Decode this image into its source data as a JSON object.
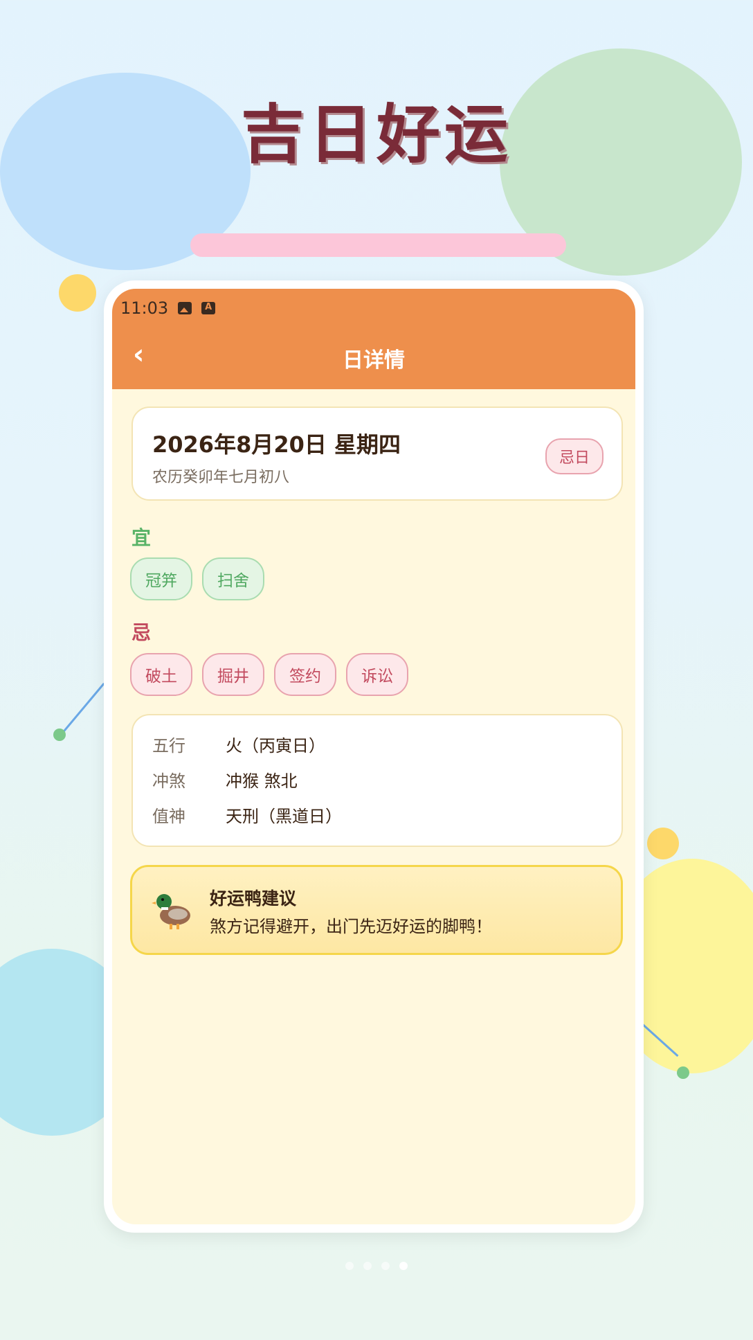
{
  "promo": {
    "headline": "吉日好运"
  },
  "status_bar": {
    "time": "11:03",
    "icons": [
      "image-icon",
      "text-a-icon"
    ]
  },
  "app_bar": {
    "back_glyph": "‹",
    "title": "日详情"
  },
  "date_card": {
    "date": "2026年8月20日 星期四",
    "lunar": "农历癸卯年七月初八",
    "badge": "忌日"
  },
  "good": {
    "label": "宜",
    "items": [
      "冠笄",
      "扫舍"
    ]
  },
  "bad": {
    "label": "忌",
    "items": [
      "破土",
      "掘井",
      "签约",
      "诉讼"
    ]
  },
  "info": {
    "rows": [
      {
        "key": "五行",
        "value": "火（丙寅日）"
      },
      {
        "key": "冲煞",
        "value": "冲猴 煞北"
      },
      {
        "key": "值神",
        "value": "天刑（黑道日）"
      }
    ]
  },
  "tip": {
    "icon": "duck-icon",
    "title": "好运鸭建议",
    "text": "煞方记得避开，出门先迈好运的脚鸭！"
  },
  "pager": {
    "count": 4,
    "active": 4
  },
  "colors": {
    "app_bar": "#ee8f4c",
    "good": "#59b367",
    "bad": "#c24a5e",
    "title": "#7a2b38"
  }
}
